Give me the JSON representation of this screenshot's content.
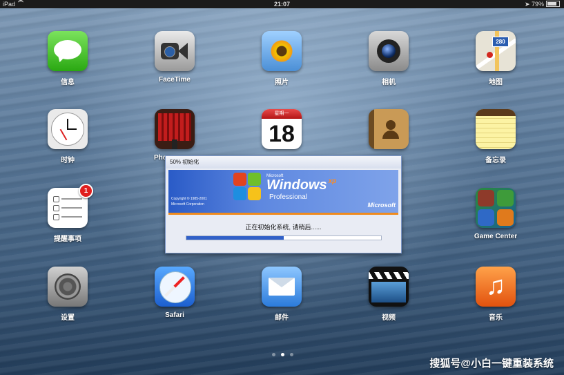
{
  "status_bar": {
    "device": "iPad",
    "time": "21:07",
    "battery": "79%",
    "battery_level": 0.79
  },
  "apps": [
    {
      "label": "信息",
      "icon": "messages-icon"
    },
    {
      "label": "FaceTime",
      "icon": "facetime-icon"
    },
    {
      "label": "照片",
      "icon": "photos-icon"
    },
    {
      "label": "相机",
      "icon": "camera-icon"
    },
    {
      "label": "地图",
      "icon": "maps-icon",
      "road_sign": "280"
    },
    {
      "label": "时钟",
      "icon": "clock-icon"
    },
    {
      "label": "Pho",
      "icon": "photo-booth-icon"
    },
    {
      "label": "",
      "icon": "calendar-icon",
      "calendar_header": "星期一",
      "calendar_day": "18"
    },
    {
      "label": "",
      "icon": "contacts-icon"
    },
    {
      "label": "备忘录",
      "icon": "notes-icon"
    },
    {
      "label": "提醒事项",
      "icon": "reminders-icon",
      "badge": "1"
    },
    {
      "label": "Game Center",
      "icon": "game-center-icon"
    },
    {
      "label": "设置",
      "icon": "settings-icon"
    },
    {
      "label": "Safari",
      "icon": "safari-icon"
    },
    {
      "label": "邮件",
      "icon": "mail-icon"
    },
    {
      "label": "视频",
      "icon": "videos-icon"
    },
    {
      "label": "音乐",
      "icon": "music-icon"
    }
  ],
  "xp_dialog": {
    "title": "50% 初始化",
    "brand_small": "Microsoft",
    "brand_name": "Windows",
    "brand_sup": "xp",
    "edition": "Professional",
    "copyright_line1": "Copyright © 1985-2001",
    "copyright_line2": "Microsoft Corporation",
    "ms_logo": "Microsoft",
    "message": "正在初始化系统, 请稍后......",
    "progress": 0.5
  },
  "page_dots": {
    "count": 3,
    "active": 1
  },
  "watermark": "搜狐号@小白一键重装系统",
  "colors": {
    "xp_banner": "#2a5bc7",
    "xp_progress": "#3060c8",
    "badge": "#e01e1e"
  }
}
